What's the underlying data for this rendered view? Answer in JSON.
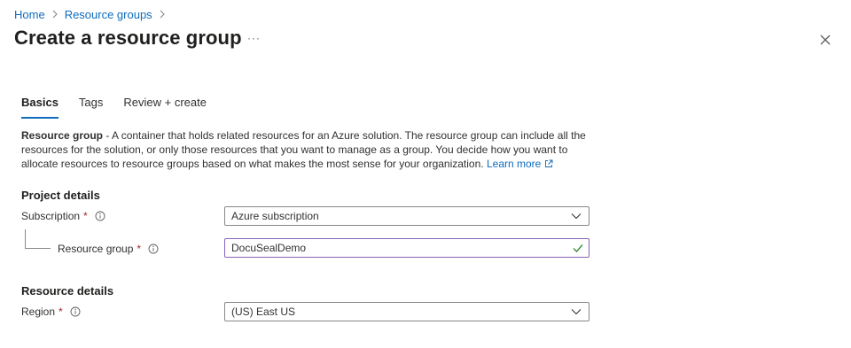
{
  "breadcrumb": {
    "items": [
      "Home",
      "Resource groups"
    ]
  },
  "page": {
    "title": "Create a resource group",
    "more_label": "···"
  },
  "tabs": [
    {
      "label": "Basics",
      "active": true
    },
    {
      "label": "Tags",
      "active": false
    },
    {
      "label": "Review + create",
      "active": false
    }
  ],
  "description": {
    "bold": "Resource group",
    "text": " - A container that holds related resources for an Azure solution. The resource group can include all the resources for the solution, or only those resources that you want to manage as a group. You decide how you want to allocate resources to resource groups based on what makes the most sense for your organization.",
    "link": "Learn more"
  },
  "project_details": {
    "title": "Project details",
    "subscription": {
      "label": "Subscription",
      "required": "*",
      "value": "Azure subscription"
    },
    "resource_group": {
      "label": "Resource group",
      "required": "*",
      "value": "DocuSealDemo"
    }
  },
  "resource_details": {
    "title": "Resource details",
    "region": {
      "label": "Region",
      "required": "*",
      "value": "(US) East US"
    }
  },
  "colors": {
    "link": "#0f6cbd",
    "required": "#a4262c",
    "valid": "#107c10",
    "focus_border": "#8764b8"
  },
  "icons": [
    "chevron-right-icon",
    "more-icon",
    "close-icon",
    "info-icon",
    "chevron-down-icon",
    "checkmark-icon",
    "external-link-icon"
  ]
}
